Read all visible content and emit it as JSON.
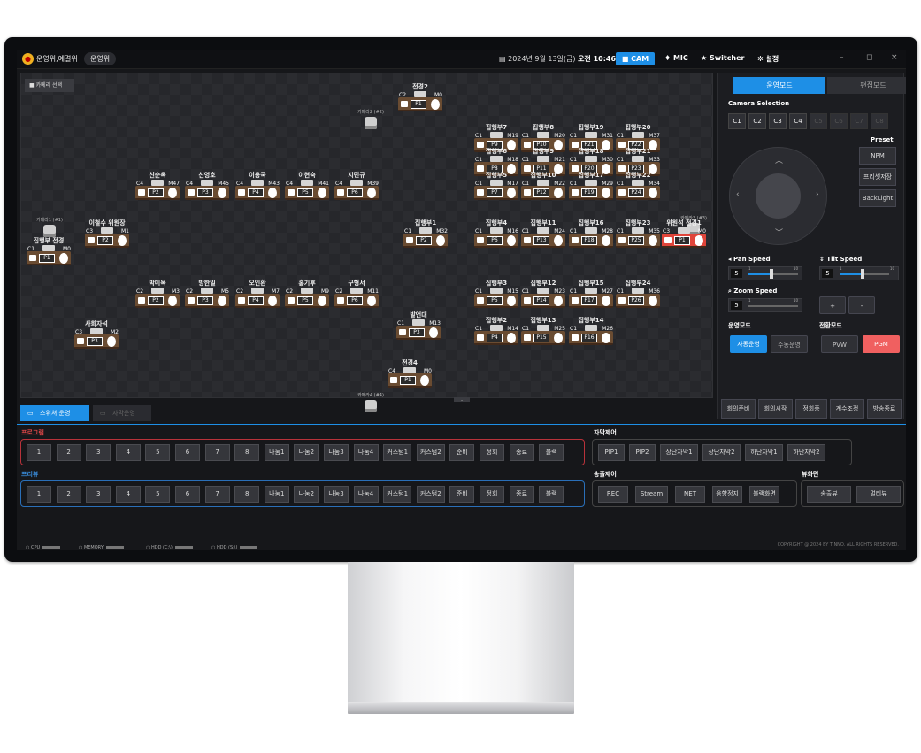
{
  "app": {
    "title": "운영위,예결위",
    "pill": "운영위",
    "datetime_prefix": "2024년 9월 13일(금)",
    "datetime_time": "오전 10:46:54"
  },
  "topbar": {
    "cam": "CAM",
    "mic": "MIC",
    "switcher": "Switcher",
    "settings": "설정",
    "min": "–",
    "max": "◻",
    "close": "×"
  },
  "stage": {
    "camera_select": "카메라 선택",
    "cameras": [
      {
        "label": "카메라2 (#2)"
      },
      {
        "label": "카메라1 (#1)"
      },
      {
        "label": "카메라3 (#3)"
      },
      {
        "label": "카메라4 (#4)"
      }
    ],
    "seats": [
      {
        "name": "전경2",
        "cam": "C2",
        "mic": "M0",
        "preset": "P1"
      },
      {
        "name": "집행부7",
        "cam": "C1",
        "mic": "M19",
        "preset": "P9"
      },
      {
        "name": "집행부8",
        "cam": "C1",
        "mic": "M20",
        "preset": "P10"
      },
      {
        "name": "집행부19",
        "cam": "C1",
        "mic": "M31",
        "preset": "P21"
      },
      {
        "name": "집행부20",
        "cam": "C1",
        "mic": "M37",
        "preset": "P22"
      },
      {
        "name": "집행부6",
        "cam": "C1",
        "mic": "M18",
        "preset": "P8"
      },
      {
        "name": "집행부9",
        "cam": "C1",
        "mic": "M21",
        "preset": "P11"
      },
      {
        "name": "집행부18",
        "cam": "C1",
        "mic": "M30",
        "preset": "P20"
      },
      {
        "name": "집행부21",
        "cam": "C1",
        "mic": "M33",
        "preset": "P23"
      },
      {
        "name": "신순옥",
        "cam": "C4",
        "mic": "M47",
        "preset": "P2"
      },
      {
        "name": "신영호",
        "cam": "C4",
        "mic": "M45",
        "preset": "P3"
      },
      {
        "name": "이용국",
        "cam": "C4",
        "mic": "M43",
        "preset": "P4"
      },
      {
        "name": "이현숙",
        "cam": "C4",
        "mic": "M41",
        "preset": "P5"
      },
      {
        "name": "지민규",
        "cam": "C4",
        "mic": "M39",
        "preset": "P6"
      },
      {
        "name": "집행부5",
        "cam": "C1",
        "mic": "M17",
        "preset": "P7"
      },
      {
        "name": "집행부10",
        "cam": "C1",
        "mic": "M22",
        "preset": "P12"
      },
      {
        "name": "집행부17",
        "cam": "C1",
        "mic": "M29",
        "preset": "P19"
      },
      {
        "name": "집행부22",
        "cam": "C1",
        "mic": "M34",
        "preset": "P24"
      },
      {
        "name": "이철수 위원장",
        "cam": "C3",
        "mic": "M1",
        "preset": "P2"
      },
      {
        "name": "집행부1",
        "cam": "C1",
        "mic": "M32",
        "preset": "P2"
      },
      {
        "name": "집행부4",
        "cam": "C1",
        "mic": "M16",
        "preset": "P6"
      },
      {
        "name": "집행부11",
        "cam": "C1",
        "mic": "M24",
        "preset": "P13"
      },
      {
        "name": "집행부16",
        "cam": "C1",
        "mic": "M28",
        "preset": "P18"
      },
      {
        "name": "집행부23",
        "cam": "C1",
        "mic": "M35",
        "preset": "P25"
      },
      {
        "name": "위원석 전경1",
        "cam": "C3",
        "mic": "M0",
        "preset": "P1",
        "live": true
      },
      {
        "name": "집행부 전경",
        "cam": "C1",
        "mic": "M0",
        "preset": "P1"
      },
      {
        "name": "박미옥",
        "cam": "C2",
        "mic": "M3",
        "preset": "P2"
      },
      {
        "name": "방한일",
        "cam": "C2",
        "mic": "M5",
        "preset": "P3"
      },
      {
        "name": "오인환",
        "cam": "C2",
        "mic": "M7",
        "preset": "P4"
      },
      {
        "name": "홍기후",
        "cam": "C2",
        "mic": "M9",
        "preset": "P5"
      },
      {
        "name": "구형서",
        "cam": "C2",
        "mic": "M11",
        "preset": "P6"
      },
      {
        "name": "집행부3",
        "cam": "C1",
        "mic": "M15",
        "preset": "P5"
      },
      {
        "name": "집행부12",
        "cam": "C1",
        "mic": "M23",
        "preset": "P14"
      },
      {
        "name": "집행부15",
        "cam": "C1",
        "mic": "M27",
        "preset": "P17"
      },
      {
        "name": "집행부24",
        "cam": "C1",
        "mic": "M36",
        "preset": "P26"
      },
      {
        "name": "발언대",
        "cam": "C1",
        "mic": "M13",
        "preset": "P3"
      },
      {
        "name": "사회자석",
        "cam": "C3",
        "mic": "M2",
        "preset": "P3"
      },
      {
        "name": "집행부2",
        "cam": "C1",
        "mic": "M14",
        "preset": "P4"
      },
      {
        "name": "집행부13",
        "cam": "C1",
        "mic": "M25",
        "preset": "P15"
      },
      {
        "name": "집행부14",
        "cam": "C1",
        "mic": "M26",
        "preset": "P16"
      },
      {
        "name": "전경4",
        "cam": "C4",
        "mic": "M0",
        "preset": "P1"
      }
    ]
  },
  "right_panel": {
    "mode_tabs": [
      "운영모드",
      "편집모드"
    ],
    "camera_selection_title": "Camera Selection",
    "cameras": [
      "C1",
      "C2",
      "C3",
      "C4",
      "C5",
      "C6",
      "C7",
      "C8"
    ],
    "preset_title": "Preset",
    "preset_buttons": [
      "NPM",
      "프리셋저장",
      "BackLight"
    ],
    "pan_speed": {
      "label": "Pan Speed",
      "value": "5",
      "min": "1",
      "max": "10"
    },
    "tilt_speed": {
      "label": "Tilt Speed",
      "value": "5",
      "min": "1",
      "max": "10"
    },
    "zoom_speed": {
      "label": "Zoom Speed",
      "value": "5",
      "min": "1",
      "max": "10"
    },
    "zoom_buttons": [
      "+",
      "-"
    ],
    "op_mode_title": "운영모드",
    "op_modes": [
      "자동운영",
      "수동운영"
    ],
    "switch_mode_title": "전환모드",
    "switch_modes": [
      "PVW",
      "PGM"
    ],
    "bottom_buttons": [
      "회의준비",
      "회의시작",
      "정회중",
      "계수조정",
      "방송종료"
    ]
  },
  "lower": {
    "tabs": [
      "스위쳐 운영",
      "자막운영"
    ],
    "program_label": "프로그램",
    "preview_label": "프리뷰",
    "keys": [
      "1",
      "2",
      "3",
      "4",
      "5",
      "6",
      "7",
      "8",
      "나눔1",
      "나눔2",
      "나눔3",
      "나눔4",
      "커스텀1",
      "커스텀2",
      "준비",
      "정회",
      "종료",
      "블랙"
    ],
    "subtitle_label": "자막제어",
    "subtitle_buttons": [
      "PIP1",
      "PIP2",
      "상단자막1",
      "상단자막2",
      "하단자막1",
      "하단자막2"
    ],
    "broadcast_label": "송출제어",
    "broadcast_buttons": [
      "REC",
      "Stream",
      "NET",
      "음향정지",
      "블랙화면"
    ],
    "view_label": "뷰화면",
    "view_buttons": [
      "송출뷰",
      "멀티뷰"
    ]
  },
  "status": {
    "cpu": "CPU",
    "memory": "MEMORY",
    "hdd_c": "HDD (C:\\)",
    "hdd_s": "HDD (S:\\)",
    "copyright": "COPYRIGHT @ 2024 BY TINNO. ALL RIGHTS RESERVED."
  }
}
